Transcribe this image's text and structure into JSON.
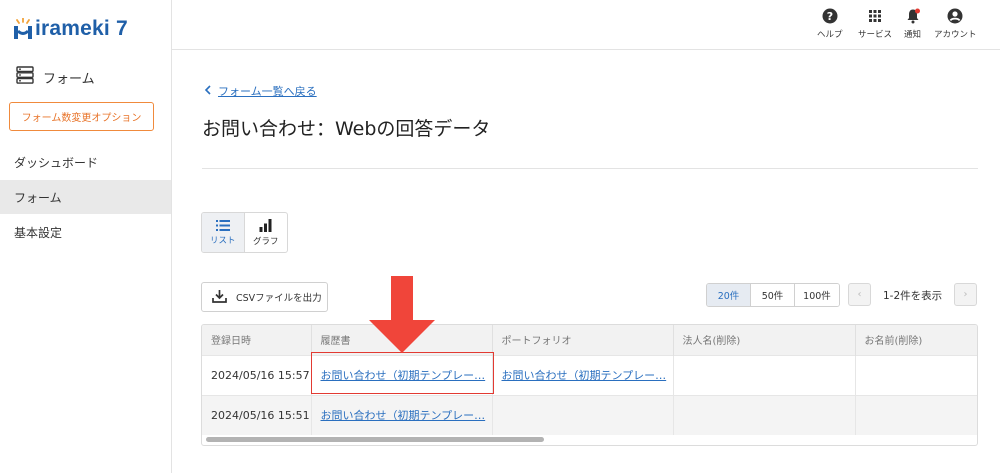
{
  "brand": {
    "name": "irameki 7"
  },
  "sidebar": {
    "section_title": "フォーム",
    "option_button": "フォーム数変更オプション",
    "items": [
      {
        "label": "ダッシュボード"
      },
      {
        "label": "フォーム"
      },
      {
        "label": "基本設定"
      }
    ]
  },
  "header": {
    "items": [
      {
        "label": "ヘルプ",
        "icon": "help-icon"
      },
      {
        "label": "サービス",
        "icon": "grid-icon"
      },
      {
        "label": "通知",
        "icon": "bell-icon"
      },
      {
        "label": "アカウント",
        "icon": "account-icon"
      }
    ]
  },
  "main": {
    "back_link": "フォーム一覧へ戻る",
    "title": "お問い合わせ：Webの回答データ",
    "view_toggle": {
      "list": "リスト",
      "graph": "グラフ"
    },
    "csv_button": "CSVファイルを出力",
    "page_sizes": [
      "20件",
      "50件",
      "100件"
    ],
    "pager_text": "1-2件を表示"
  },
  "table": {
    "columns": [
      "登録日時",
      "履歴書",
      "ポートフォリオ",
      "法人名(削除)",
      "お名前(削除)"
    ],
    "rows": [
      [
        "2024/05/16 15:57",
        "お問い合わせ（初期テンプレー…",
        "お問い合わせ（初期テンプレー…",
        "",
        ""
      ],
      [
        "2024/05/16 15:51",
        "お問い合わせ（初期テンプレー…",
        "",
        "",
        ""
      ]
    ]
  },
  "colors": {
    "accent": "#2a6fbf",
    "brand": "#1f5fa8",
    "option_orange": "#e8742a",
    "annotation_red": "#e23a32"
  }
}
